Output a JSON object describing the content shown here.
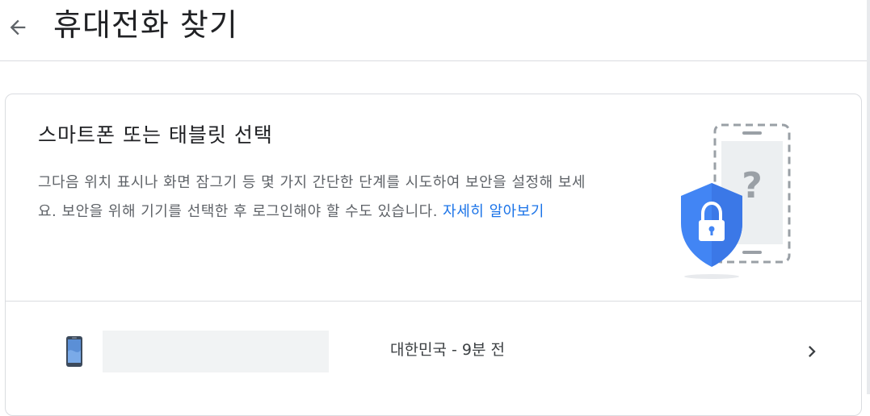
{
  "header": {
    "back_icon": "arrow-left-icon",
    "title": "휴대전화 찾기"
  },
  "card": {
    "title": "스마트폰 또는 태블릿 선택",
    "description": "그다음 위치 표시나 화면 잠그기 등 몇 가지 간단한 단계를 시도하여 보안을 설정해 보세요. 보안을 위해 기기를 선택한 후 로그인해야 할 수도 있습니다.",
    "learn_more": "자세히 알아보기",
    "illustration_icons": [
      "shield-lock-icon",
      "phone-question-icon"
    ]
  },
  "devices": [
    {
      "icon": "smartphone-icon",
      "status": "대한민국 - 9분 전",
      "chevron_icon": "chevron-right-icon"
    }
  ],
  "colors": {
    "accent": "#1a73e8",
    "text_primary": "#202124",
    "text_secondary": "#5f6368",
    "border": "#dadce0",
    "shield": "#4285f4"
  }
}
